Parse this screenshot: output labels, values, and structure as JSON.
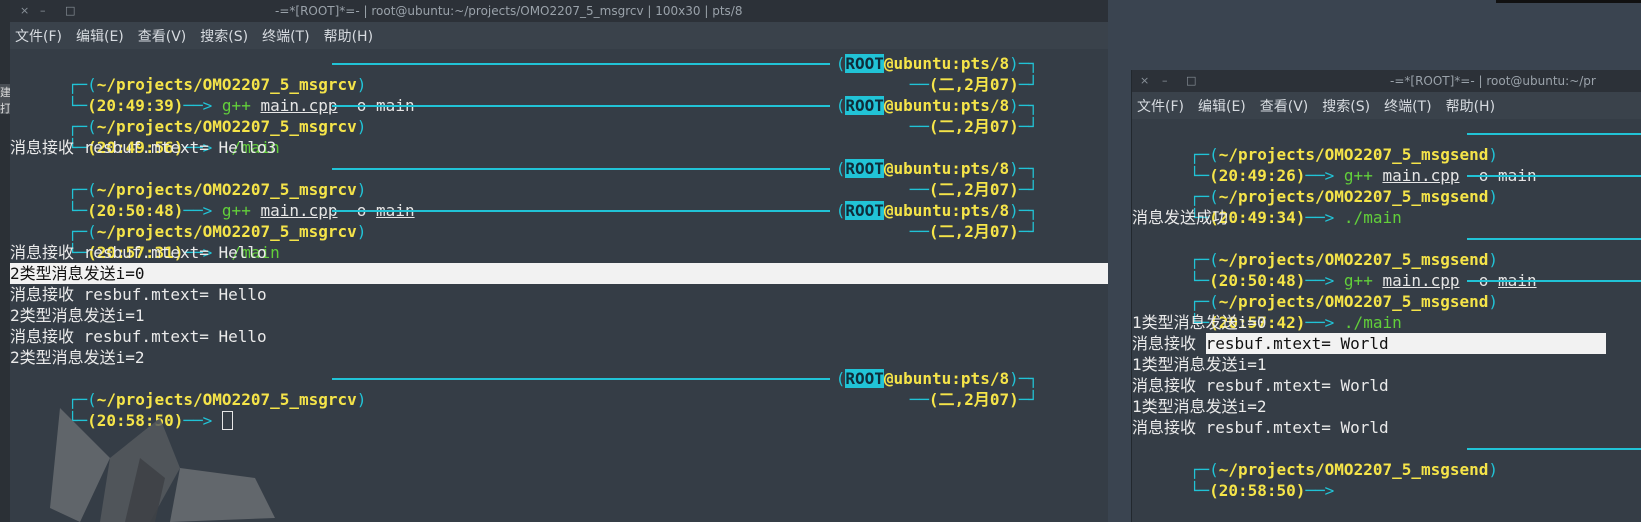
{
  "left_window": {
    "title": "-=*[ROOT]*=- | root@ubuntu:~/projects/OMO2207_5_msgrcv | 100x30 | pts/8",
    "controls": [
      "×",
      "–",
      "□"
    ],
    "menu": [
      "文件(F)",
      "编辑(E)",
      "查看(V)",
      "搜索(S)",
      "终端(T)",
      "帮助(H)"
    ],
    "prompt_path": "~/projects/OMO2207_5_msgrcv",
    "root_badge": "ROOT",
    "host": "@ubuntu:pts/8",
    "date": "(二,2月07)",
    "blocks": [
      {
        "time": "(20:49:39)",
        "cmd_pre": "g++ ",
        "cmd_ul": "main.cpp",
        "cmd_post": " -o main",
        "cmd_ul2": ""
      },
      {
        "time": "(20:49:56)",
        "cmd_pre": "./main",
        "cmd_ul": "",
        "cmd_post": "",
        "cmd_ul2": ""
      },
      {
        "time": "(20:50:48)",
        "cmd_pre": "g++ ",
        "cmd_ul": "main.cpp",
        "cmd_post": " -o ",
        "cmd_ul2": "main"
      },
      {
        "time": "(20:57:31)",
        "cmd_pre": "./main",
        "cmd_ul": "",
        "cmd_post": "",
        "cmd_ul2": ""
      },
      {
        "time": "(20:58:50)"
      }
    ],
    "output_1": "消息接收 resbuf.mtext= Hello3",
    "output_2": [
      "消息接收 resbuf.mtext= Hello",
      "2类型消息发送i=0",
      "消息接收 resbuf.mtext= Hello",
      "2类型消息发送i=1",
      "消息接收 resbuf.mtext= Hello",
      "2类型消息发送i=2"
    ]
  },
  "right_window": {
    "title": "-=*[ROOT]*=- | root@ubuntu:~/pr",
    "controls": [
      "×",
      "–",
      "□"
    ],
    "menu": [
      "文件(F)",
      "编辑(E)",
      "查看(V)",
      "搜索(S)",
      "终端(T)",
      "帮助(H)"
    ],
    "prompt_path": "~/projects/OMO2207_5_msgsend",
    "blocks": [
      {
        "time": "(20:49:26)",
        "cmd_pre": "g++ ",
        "cmd_ul": "main.cpp",
        "cmd_post": " -o main",
        "cmd_ul2": ""
      },
      {
        "time": "(20:49:34)",
        "cmd_pre": "./main",
        "cmd_ul": "",
        "cmd_post": "",
        "cmd_ul2": ""
      },
      {
        "time": "(20:50:48)",
        "cmd_pre": "g++ ",
        "cmd_ul": "main.cpp",
        "cmd_post": " -o ",
        "cmd_ul2": "main"
      },
      {
        "time": "(20:57:42)",
        "cmd_pre": "./main",
        "cmd_ul": "",
        "cmd_post": "",
        "cmd_ul2": ""
      },
      {
        "time": "(20:58:50)"
      }
    ],
    "output_1": "消息发送成功",
    "output_2": [
      "1类型消息发送i=0",
      "消息接收 ",
      "resbuf.mtext= World",
      "1类型消息发送i=1",
      "消息接收 resbuf.mtext= World",
      "1类型消息发送i=2",
      "消息接收 resbuf.mtext= World"
    ]
  },
  "desktop": {
    "side_tag": "建打包"
  },
  "colors": {
    "frame": "#21c3d6",
    "path": "#f5e449",
    "command": "#62cf3a",
    "background": "#353d46"
  }
}
